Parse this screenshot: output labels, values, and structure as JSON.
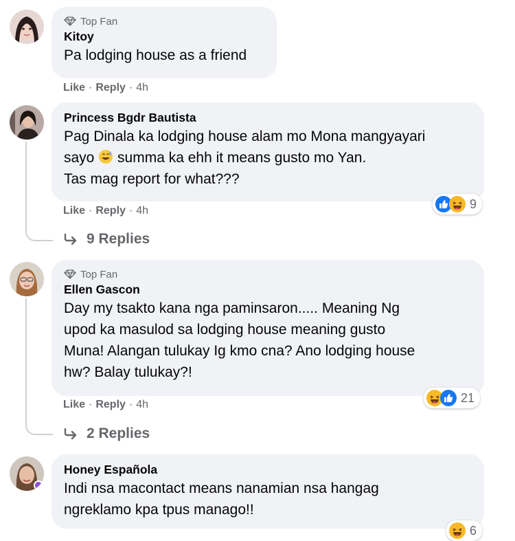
{
  "comments": [
    {
      "badge": "Top Fan",
      "name": "Kitoy",
      "text": "Pa lodging house as a friend",
      "like": "Like",
      "reply": "Reply",
      "time": "4h"
    },
    {
      "name": "Princess Bgdr Bautista",
      "text_before_emoji": "Pag Dinala ka lodging house alam mo Mona mangyayari\nsayo ",
      "emoji": "grinning-sweat-emoji",
      "text_after_emoji": " summa ka ehh it means gusto mo Yan.\nTas mag report for what???",
      "like": "Like",
      "reply": "Reply",
      "time": "4h",
      "reaction_count": "9",
      "reaction_icons": [
        "like-icon",
        "haha-icon"
      ],
      "replies_label": "9 Replies"
    },
    {
      "badge": "Top Fan",
      "name": "Ellen Gascon",
      "text": "Day my tsakto kana nga paminsaron..... Meaning Ng\nupod ka masulod sa lodging house meaning gusto\nMuna! Alangan tulukay Ig kmo cna? Ano lodging house\nhw? Balay tulukay?!",
      "like": "Like",
      "reply": "Reply",
      "time": "4h",
      "reaction_count": "21",
      "reaction_icons": [
        "haha-icon",
        "like-icon"
      ],
      "replies_label": "2 Replies"
    },
    {
      "name": "Honey Española",
      "text": "Indi nsa macontact means nanamian nsa hangag\nngreklamo kpa tpus manago!!",
      "reaction_count": "6",
      "reaction_icons": [
        "haha-icon"
      ]
    }
  ],
  "colors": {
    "bubble": "#f0f2f5",
    "secondary_text": "#65676b",
    "like_blue": "#1877f2",
    "haha_yellow": "#f7b928"
  }
}
